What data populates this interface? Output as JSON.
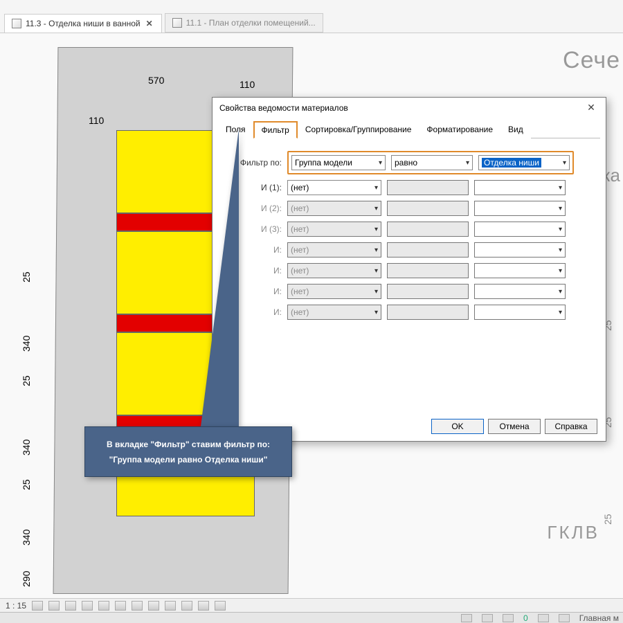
{
  "docTabs": {
    "active": {
      "label": "11.3 - Отделка ниши в ванной"
    },
    "inactive": {
      "label": "11.1 - План отделки помещений..."
    }
  },
  "viewportText": {
    "sectionHint": "Сече",
    "gklv": "ГКЛВ",
    "ka": "ка",
    "dimsTop": {
      "d570": "570",
      "d110a": "110",
      "d110b": "110"
    },
    "dimsLeft": {
      "d25a": "25",
      "d340a": "340",
      "d25b": "25",
      "d340b": "340",
      "d25c": "25",
      "d340c": "340",
      "d290": "290"
    },
    "dimsRight": {
      "r25a": "25",
      "r25b": "25",
      "r25c": "25"
    }
  },
  "viewbar": {
    "scale": "1 : 15"
  },
  "statusbar": {
    "zero": "0",
    "main": "Главная м"
  },
  "dialog": {
    "title": "Свойства ведомости материалов",
    "tabs": {
      "fields": "Поля",
      "filter": "Фильтр",
      "sort": "Сортировка/Группирование",
      "format": "Форматирование",
      "view": "Вид"
    },
    "rows": {
      "r0": {
        "label": "Фильтр по:",
        "c1": "Группа модели",
        "c2": "равно",
        "c3": "Отделка ниши"
      },
      "r1": {
        "label": "И (1):",
        "c1": "(нет)"
      },
      "r2": {
        "label": "И (2):",
        "c1": "(нет)"
      },
      "r3": {
        "label": "И (3):",
        "c1": "(нет)"
      },
      "r4": {
        "label": "И:",
        "c1": "(нет)"
      },
      "r5": {
        "label": "И:",
        "c1": "(нет)"
      },
      "r6": {
        "label": "И:",
        "c1": "(нет)"
      },
      "r7": {
        "label": "И:",
        "c1": "(нет)"
      }
    },
    "buttons": {
      "ok": "OK",
      "cancel": "Отмена",
      "help": "Справка"
    }
  },
  "callout": {
    "text": "В вкладке \"Фильтр\" ставим фильтр по: \"Группа модели равно Отделка ниши\""
  }
}
